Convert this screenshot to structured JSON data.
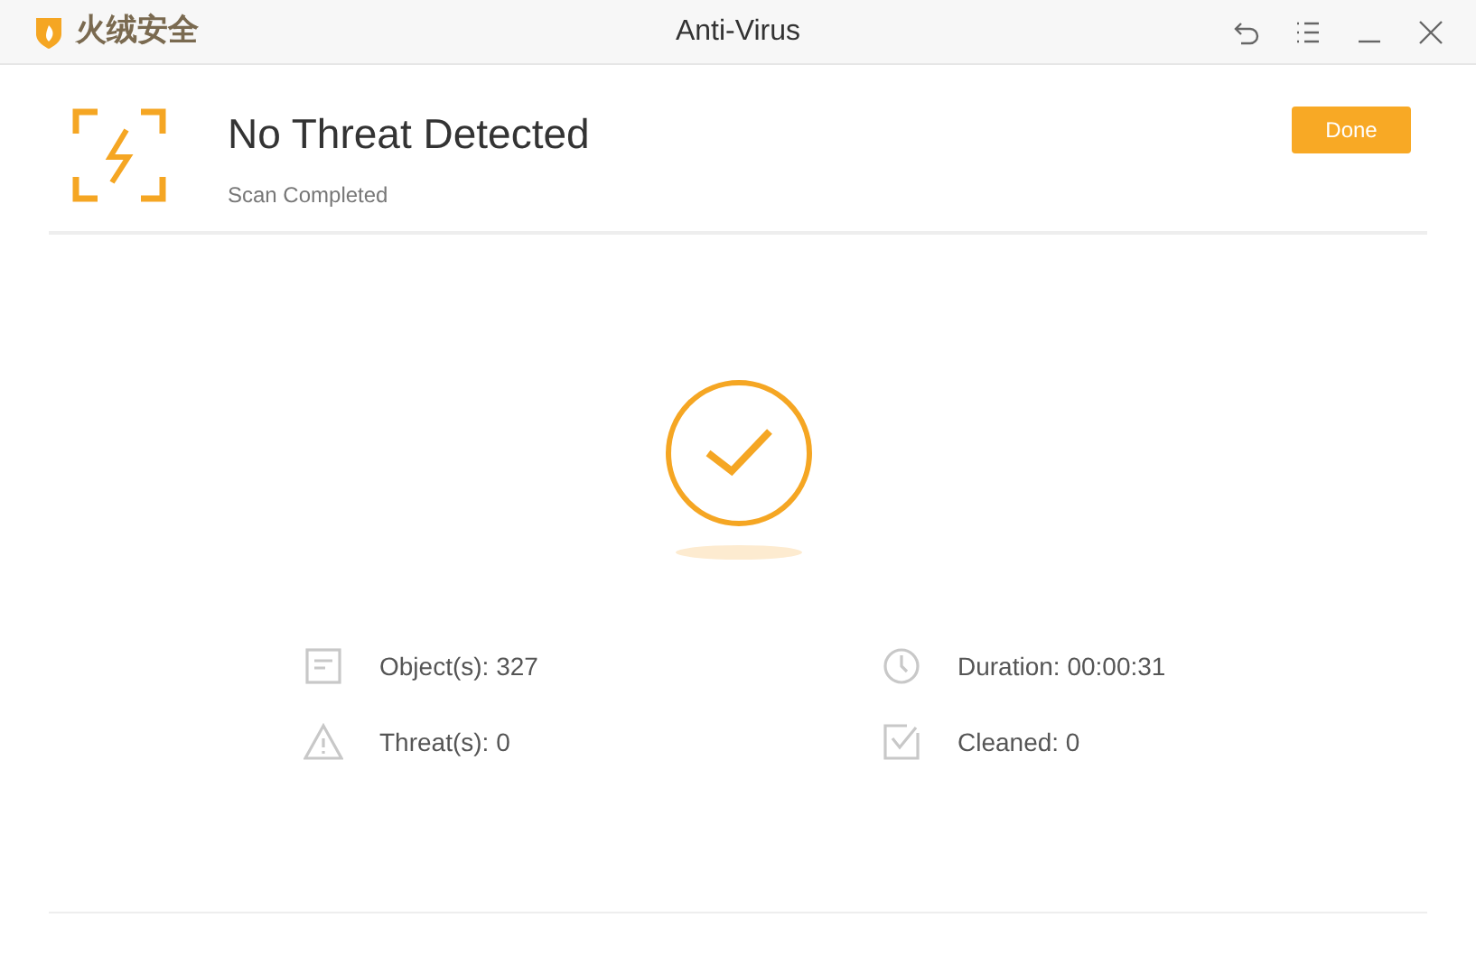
{
  "window": {
    "brand": "火绒安全",
    "title": "Anti-Virus"
  },
  "header": {
    "title": "No Threat Detected",
    "subtitle": "Scan Completed",
    "button": "Done"
  },
  "stats": [
    {
      "kind": "objects",
      "label": "Object(s): 327"
    },
    {
      "kind": "duration",
      "label": "Duration: 00:00:31"
    },
    {
      "kind": "threats",
      "label": "Threat(s): 0"
    },
    {
      "kind": "cleaned",
      "label": "Cleaned: 0"
    }
  ]
}
